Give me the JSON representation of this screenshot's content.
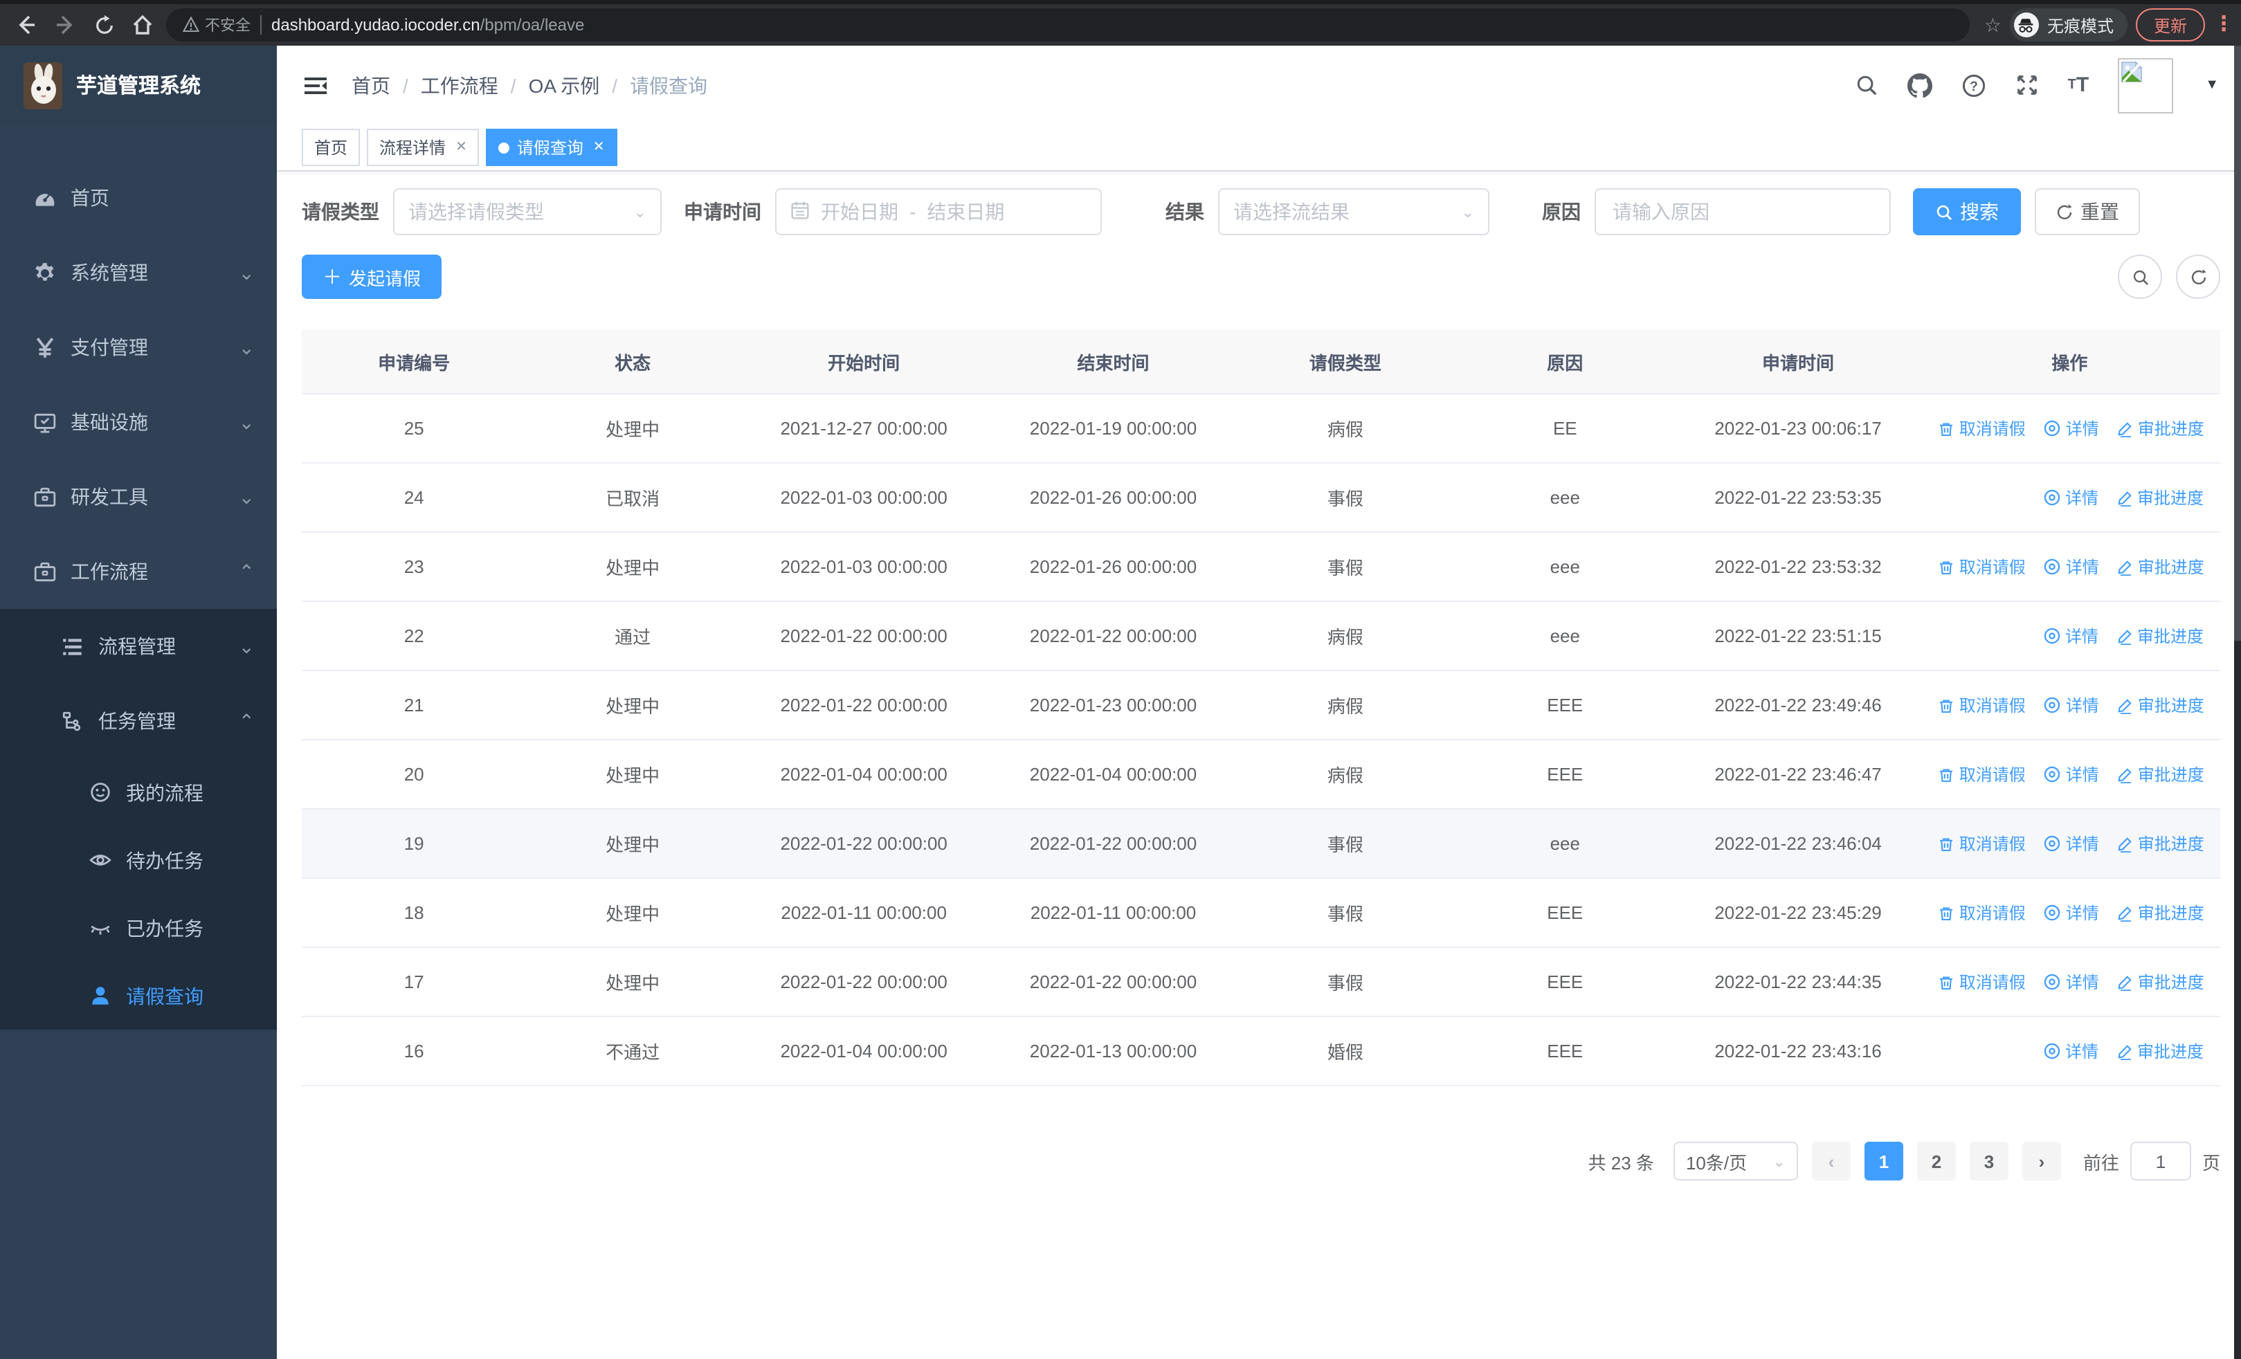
{
  "browser": {
    "security_label": "不安全",
    "url_host": "dashboard.yudao.iocoder.cn",
    "url_path": "/bpm/oa/leave",
    "incognito_label": "无痕模式",
    "update_label": "更新"
  },
  "sidebar": {
    "app_title": "芋道管理系统",
    "items": [
      {
        "label": "首页",
        "icon": "dashboard-icon",
        "level": 0
      },
      {
        "label": "系统管理",
        "icon": "gear-icon",
        "level": 0,
        "chevron": "down"
      },
      {
        "label": "支付管理",
        "icon": "yen-icon",
        "level": 0,
        "chevron": "down"
      },
      {
        "label": "基础设施",
        "icon": "monitor-icon",
        "level": 0,
        "chevron": "down"
      },
      {
        "label": "研发工具",
        "icon": "toolbox-icon",
        "level": 0,
        "chevron": "down"
      },
      {
        "label": "工作流程",
        "icon": "briefcase-icon",
        "level": 0,
        "chevron": "up"
      }
    ],
    "submenu": [
      {
        "label": "流程管理",
        "icon": "list-tree-icon",
        "level": 1,
        "chevron": "down"
      },
      {
        "label": "任务管理",
        "icon": "flow-icon",
        "level": 1,
        "chevron": "up"
      },
      {
        "label": "我的流程",
        "icon": "face-icon",
        "level": 2
      },
      {
        "label": "待办任务",
        "icon": "eye-open-icon",
        "level": 2
      },
      {
        "label": "已办任务",
        "icon": "eye-closed-icon",
        "level": 2
      },
      {
        "label": "请假查询",
        "icon": "user-icon",
        "level": 2,
        "active": true
      }
    ]
  },
  "header": {
    "breadcrumb": [
      "首页",
      "工作流程",
      "OA 示例",
      "请假查询"
    ],
    "icons": [
      "search-icon",
      "github-icon",
      "help-icon",
      "fullscreen-icon",
      "font-size-icon",
      "avatar-broken-image",
      "caret-down-icon"
    ]
  },
  "tabs": [
    {
      "label": "首页",
      "closable": false,
      "active": false
    },
    {
      "label": "流程详情",
      "closable": true,
      "active": false
    },
    {
      "label": "请假查询",
      "closable": true,
      "active": true
    }
  ],
  "filters": {
    "leave_type_label": "请假类型",
    "leave_type_placeholder": "请选择请假类型",
    "apply_time_label": "申请时间",
    "date_start_placeholder": "开始日期",
    "date_sep": "-",
    "date_end_placeholder": "结束日期",
    "result_label": "结果",
    "result_placeholder": "请选择流结果",
    "reason_label": "原因",
    "reason_placeholder": "请输入原因",
    "search_label": "搜索",
    "reset_label": "重置"
  },
  "toolbar": {
    "create_label": "发起请假"
  },
  "table": {
    "columns": [
      "申请编号",
      "状态",
      "开始时间",
      "结束时间",
      "请假类型",
      "原因",
      "申请时间",
      "操作"
    ],
    "col_widths": [
      "11.7%",
      "11.1%",
      "13.0%",
      "13.0%",
      "11.2%",
      "11.7%",
      "12.6%",
      "15.7%"
    ],
    "action_labels": {
      "cancel": "取消请假",
      "detail": "详情",
      "progress": "审批进度"
    },
    "rows": [
      {
        "id": "25",
        "status": "处理中",
        "start": "2021-12-27 00:00:00",
        "end": "2022-01-19 00:00:00",
        "type": "病假",
        "reason": "EE",
        "applied": "2022-01-23 00:06:17",
        "actions": [
          "cancel",
          "detail",
          "progress"
        ],
        "highlight": false
      },
      {
        "id": "24",
        "status": "已取消",
        "start": "2022-01-03 00:00:00",
        "end": "2022-01-26 00:00:00",
        "type": "事假",
        "reason": "eee",
        "applied": "2022-01-22 23:53:35",
        "actions": [
          "detail",
          "progress"
        ],
        "highlight": false
      },
      {
        "id": "23",
        "status": "处理中",
        "start": "2022-01-03 00:00:00",
        "end": "2022-01-26 00:00:00",
        "type": "事假",
        "reason": "eee",
        "applied": "2022-01-22 23:53:32",
        "actions": [
          "cancel",
          "detail",
          "progress"
        ],
        "highlight": false
      },
      {
        "id": "22",
        "status": "通过",
        "start": "2022-01-22 00:00:00",
        "end": "2022-01-22 00:00:00",
        "type": "病假",
        "reason": "eee",
        "applied": "2022-01-22 23:51:15",
        "actions": [
          "detail",
          "progress"
        ],
        "highlight": false
      },
      {
        "id": "21",
        "status": "处理中",
        "start": "2022-01-22 00:00:00",
        "end": "2022-01-23 00:00:00",
        "type": "病假",
        "reason": "EEE",
        "applied": "2022-01-22 23:49:46",
        "actions": [
          "cancel",
          "detail",
          "progress"
        ],
        "highlight": false
      },
      {
        "id": "20",
        "status": "处理中",
        "start": "2022-01-04 00:00:00",
        "end": "2022-01-04 00:00:00",
        "type": "病假",
        "reason": "EEE",
        "applied": "2022-01-22 23:46:47",
        "actions": [
          "cancel",
          "detail",
          "progress"
        ],
        "highlight": false
      },
      {
        "id": "19",
        "status": "处理中",
        "start": "2022-01-22 00:00:00",
        "end": "2022-01-22 00:00:00",
        "type": "事假",
        "reason": "eee",
        "applied": "2022-01-22 23:46:04",
        "actions": [
          "cancel",
          "detail",
          "progress"
        ],
        "highlight": true
      },
      {
        "id": "18",
        "status": "处理中",
        "start": "2022-01-11 00:00:00",
        "end": "2022-01-11 00:00:00",
        "type": "事假",
        "reason": "EEE",
        "applied": "2022-01-22 23:45:29",
        "actions": [
          "cancel",
          "detail",
          "progress"
        ],
        "highlight": false
      },
      {
        "id": "17",
        "status": "处理中",
        "start": "2022-01-22 00:00:00",
        "end": "2022-01-22 00:00:00",
        "type": "事假",
        "reason": "EEE",
        "applied": "2022-01-22 23:44:35",
        "actions": [
          "cancel",
          "detail",
          "progress"
        ],
        "highlight": false
      },
      {
        "id": "16",
        "status": "不通过",
        "start": "2022-01-04 00:00:00",
        "end": "2022-01-13 00:00:00",
        "type": "婚假",
        "reason": "EEE",
        "applied": "2022-01-22 23:43:16",
        "actions": [
          "detail",
          "progress"
        ],
        "highlight": false
      }
    ]
  },
  "pagination": {
    "total_label": "共 23 条",
    "page_size_value": "10条/页",
    "pages": [
      "1",
      "2",
      "3"
    ],
    "active_page": "1",
    "goto_label": "前往",
    "goto_value": "1",
    "goto_suffix": "页"
  },
  "colors": {
    "primary": "#409EFF",
    "sidebar_bg": "#304156",
    "submenu_bg": "#1f2d3d",
    "sidebar_text": "#bfcbd9",
    "table_header_bg": "#f8f8f9",
    "table_header_text": "#515a6e",
    "body_text": "#606266",
    "chrome_accent": "#ee8277"
  }
}
